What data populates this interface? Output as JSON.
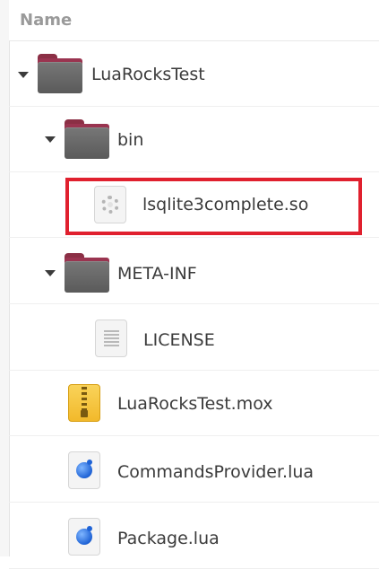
{
  "header": {
    "name_label": "Name"
  },
  "tree": {
    "root": {
      "label": "LuaRocksTest",
      "icon": "folder-icon",
      "expanded": true
    },
    "bin": {
      "label": "bin",
      "icon": "folder-icon",
      "expanded": true
    },
    "so_file": {
      "label": "lsqlite3complete.so",
      "icon": "shared-library-icon"
    },
    "meta": {
      "label": "META-INF",
      "icon": "folder-icon",
      "expanded": true
    },
    "license": {
      "label": "LICENSE",
      "icon": "text-file-icon"
    },
    "mox": {
      "label": "LuaRocksTest.mox",
      "icon": "archive-icon"
    },
    "commands": {
      "label": "CommandsProvider.lua",
      "icon": "lua-file-icon"
    },
    "package": {
      "label": "Package.lua",
      "icon": "lua-file-icon"
    }
  },
  "highlight_color": "#e0202e"
}
